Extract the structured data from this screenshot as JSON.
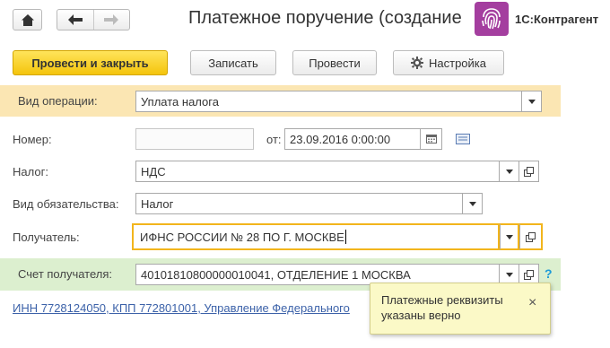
{
  "nav": {
    "home_icon": "home-icon",
    "back_icon": "arrow-left-icon",
    "forward_icon": "arrow-right-icon"
  },
  "header": {
    "title": "Платежное поручение (создание",
    "brand": "1С:Контрагент"
  },
  "toolbar": {
    "post_close_label": "Провести и закрыть",
    "save_label": "Записать",
    "post_label": "Провести",
    "settings_label": "Настройка"
  },
  "form": {
    "operation": {
      "label": "Вид операции:",
      "value": "Уплата налога"
    },
    "number": {
      "label": "Номер:",
      "value": "",
      "date_label": "от:",
      "date_value": "23.09.2016  0:00:00"
    },
    "tax": {
      "label": "Налог:",
      "value": "НДС"
    },
    "obligation": {
      "label": "Вид обязательства:",
      "value": "Налог"
    },
    "recipient": {
      "label": "Получатель:",
      "value": "ИФНС РОССИИ № 28 ПО Г. МОСКВЕ"
    },
    "account": {
      "label": "Счет получателя:",
      "value": "40101810800000010041, ОТДЕЛЕНИЕ 1 МОСКВА",
      "help": "?"
    },
    "details_link": "ИНН 7728124050, КПП 772801001, Управление Федерального"
  },
  "tooltip": {
    "text": "Платежные реквизиты указаны верно",
    "close": "×"
  },
  "colors": {
    "primary": "#f4c40c",
    "operation_band": "#fbe6b3",
    "account_band": "#dcefcf",
    "focus_border": "#f2b51c",
    "link": "#3c62a9",
    "brand_purple": "#a43e9f"
  }
}
